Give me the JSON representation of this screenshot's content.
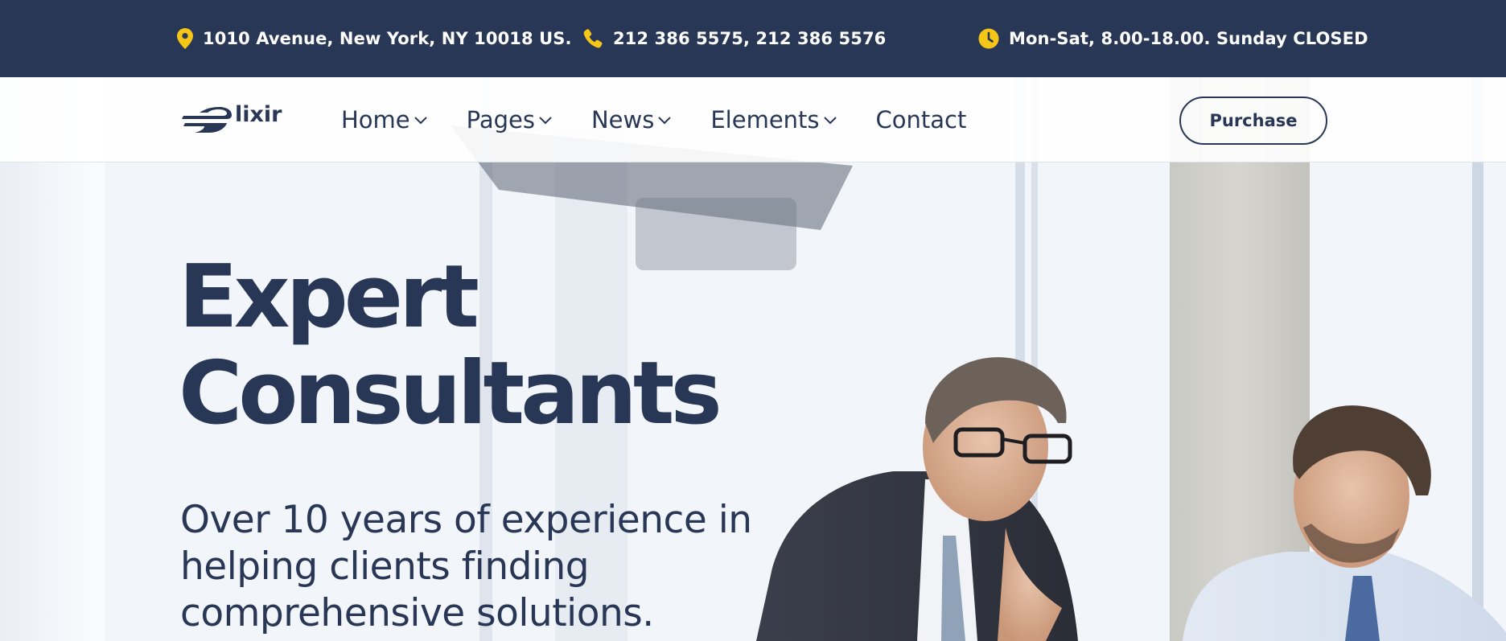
{
  "topbar": {
    "address": "1010 Avenue, New York, NY 10018 US.",
    "phone": "212 386 5575, 212 386 5576",
    "hours": "Mon-Sat, 8.00-18.00. Sunday CLOSED",
    "icons": {
      "address": "map-pin-icon",
      "phone": "phone-icon",
      "hours": "clock-icon"
    },
    "icon_color": "#f5c518"
  },
  "brand": {
    "logo_text": "lixir"
  },
  "nav": {
    "items": [
      {
        "label": "Home",
        "has_dropdown": true
      },
      {
        "label": "Pages",
        "has_dropdown": true
      },
      {
        "label": "News",
        "has_dropdown": true
      },
      {
        "label": "Elements",
        "has_dropdown": true
      },
      {
        "label": "Contact",
        "has_dropdown": false
      }
    ],
    "cta_label": "Purchase"
  },
  "hero": {
    "title_line1": "Expert",
    "title_line2": "Consultants",
    "subtitle_line1": "Over 10 years of experience in",
    "subtitle_line2": "helping clients finding",
    "subtitle_line3": "comprehensive solutions."
  },
  "colors": {
    "primary": "#283755",
    "accent": "#f5c518",
    "background": "#f3f6fa"
  }
}
